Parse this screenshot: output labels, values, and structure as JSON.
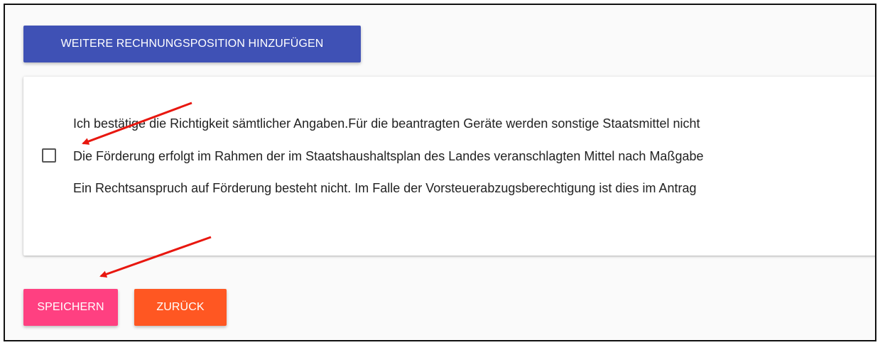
{
  "toolbar": {
    "add_position_label": "WEITERE RECHNUNGSPOSITION HINZUFÜGEN"
  },
  "confirmation": {
    "checked": false,
    "lines": [
      "Ich bestätige die Richtigkeit sämtlicher Angaben.Für die beantragten Geräte werden sonstige Staatsmittel nicht",
      "Die Förderung erfolgt im Rahmen der im Staatshaushaltsplan des Landes veranschlagten Mittel nach Maßgabe",
      "Ein Rechtsanspruch auf Förderung besteht nicht. Im Falle der Vorsteuerabzugsberechtigung ist dies im Antrag"
    ]
  },
  "actions": {
    "save_label": "SPEICHERN",
    "back_label": "ZURÜCK"
  },
  "colors": {
    "primary": "#3f51b5",
    "save": "#ff4081",
    "back": "#ff5722",
    "annotation_arrow": "#e8170f"
  },
  "annotations": {
    "arrow_icon": "red-arrow-icon"
  }
}
